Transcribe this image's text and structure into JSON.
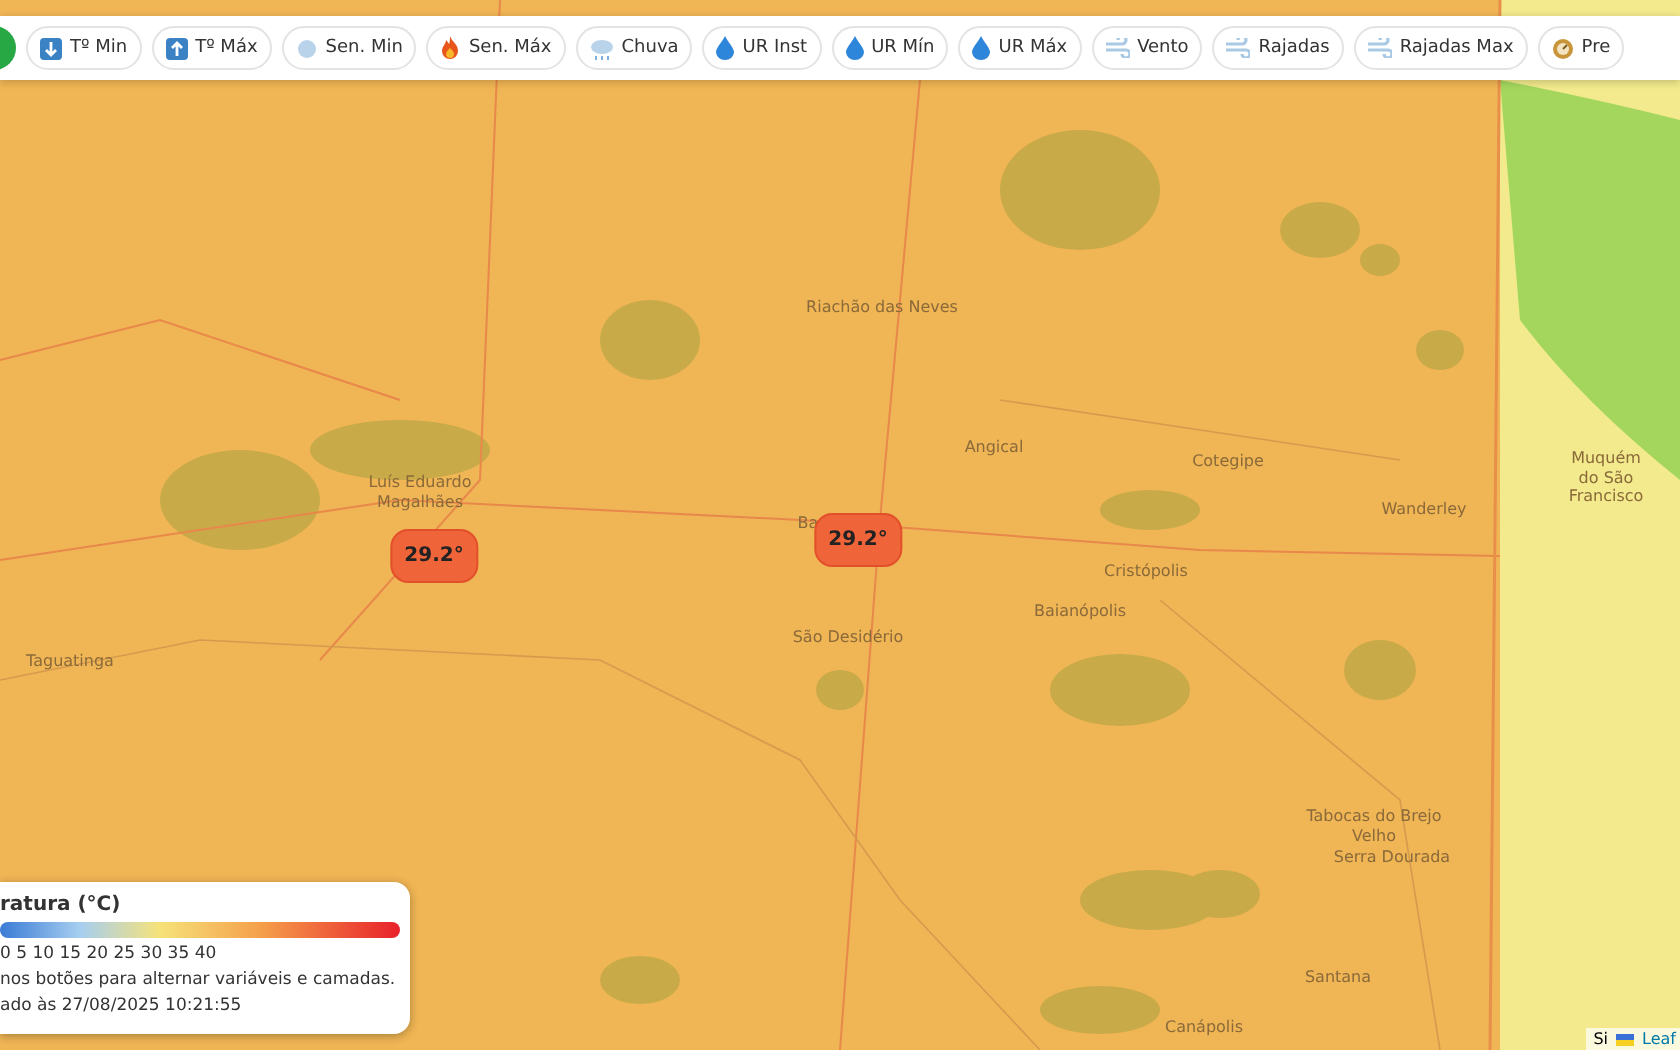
{
  "toolbar": {
    "buttons": [
      {
        "kind": "min",
        "label": "Tº Min"
      },
      {
        "kind": "max",
        "label": "Tº Máx"
      },
      {
        "kind": "cold",
        "label": "Sen. Min"
      },
      {
        "kind": "hot",
        "label": "Sen. Máx"
      },
      {
        "kind": "rain",
        "label": "Chuva"
      },
      {
        "kind": "drop",
        "label": "UR Inst"
      },
      {
        "kind": "drop",
        "label": "UR Mín"
      },
      {
        "kind": "drop",
        "label": "UR Máx"
      },
      {
        "kind": "wind",
        "label": "Vento"
      },
      {
        "kind": "wind",
        "label": "Rajadas"
      },
      {
        "kind": "wind",
        "label": "Rajadas Max"
      },
      {
        "kind": "pressure",
        "label": "Pre"
      }
    ]
  },
  "map": {
    "places": [
      "Riachão das Neves",
      "Luís Eduardo Magalhães",
      "Angical",
      "Cotegipe",
      "Wanderley",
      "Muquém do São Francisco",
      "Ba",
      "Cristópolis",
      "Baianópolis",
      "São Desidério",
      "Taguatinga",
      "Tabocas do Brejo Velho",
      "Serra Dourada",
      "Santana",
      "Canápolis"
    ],
    "markers": [
      {
        "value": "29.2°"
      },
      {
        "value": "29.2°"
      }
    ]
  },
  "legend": {
    "title": "ratura (°C)",
    "scale": "0 5 10 15 20 25 30 35 40",
    "hint": "nos botões para alternar variáveis e camadas.",
    "updated": "ado às 27/08/2025 10:21:55"
  },
  "attribution": {
    "text": "Si",
    "link": "Leaf"
  }
}
